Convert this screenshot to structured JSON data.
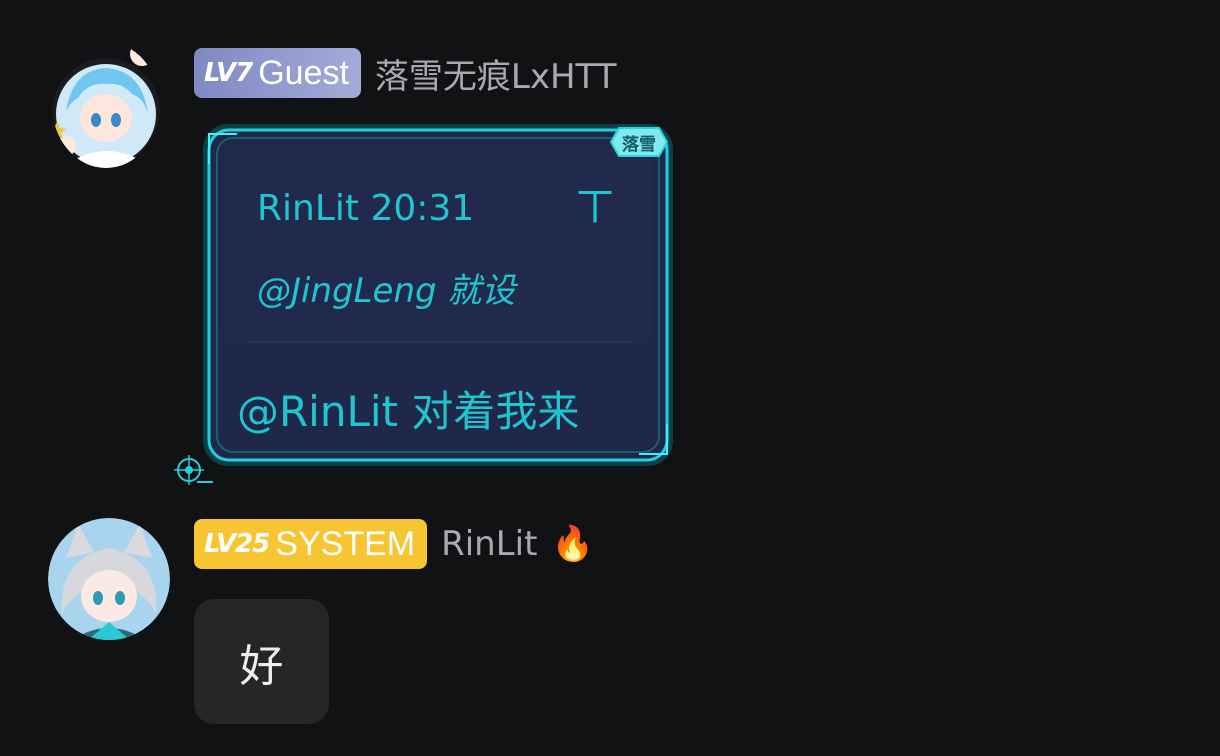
{
  "messages": [
    {
      "badge_level": "LV7",
      "badge_role": "Guest",
      "username": "落雪无痕LxHTT",
      "bubble_tag": "落雪",
      "quote": {
        "author_time": "RinLit 20:31",
        "jump_glyph": "ㄒ",
        "text": "@JingLeng 就设"
      },
      "reply_text": "@RinLit 对着我来"
    },
    {
      "badge_level": "LV25",
      "badge_role": "SYSTEM",
      "username": "RinLit",
      "status_emoji": "🔥",
      "text": "好"
    }
  ],
  "colors": {
    "background": "#111214",
    "guest_badge": "#8f98cc",
    "system_badge": "#f7c531",
    "bubble_fill": "#1f2848",
    "bubble_accent": "#21d0dc",
    "plain_bubble": "#252628"
  }
}
